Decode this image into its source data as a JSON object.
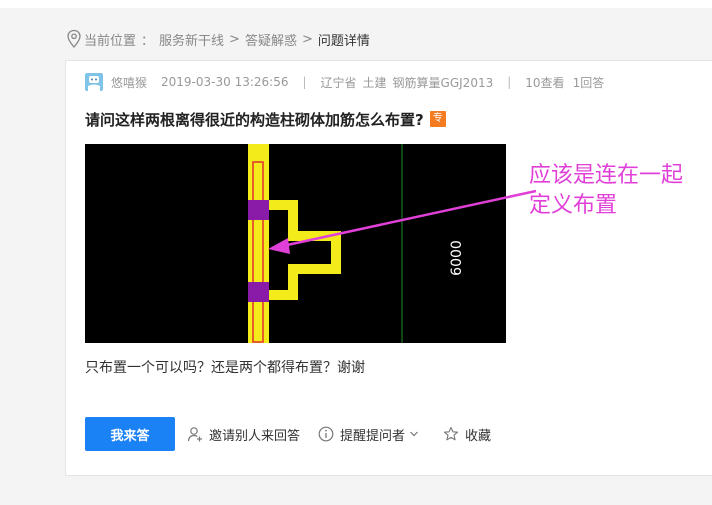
{
  "breadcrumb": {
    "prefix": "当前位置",
    "colon": "：",
    "items": [
      "服务新干线",
      "答疑解惑"
    ],
    "current": "问题详情",
    "separator": ">"
  },
  "question": {
    "user": "悠嘻猴",
    "date": "2019-03-30 13:26:56",
    "bar": "|",
    "region": "辽宁省",
    "category": "土建",
    "software": "钢筋算量GGJ2013",
    "views": "10查看",
    "answers": "1回答",
    "title": "请问这样两根离得很近的构造柱砌体加筋怎么布置?",
    "badge": "专",
    "body": "只布置一个可以吗？还是两个都得布置？谢谢"
  },
  "figure": {
    "dimension_label": "6000",
    "annotation_line1": "应该是连在一起",
    "annotation_line2": "定义布置"
  },
  "actions": {
    "answer": "我来答",
    "invite": "邀请别人来回答",
    "remind": "提醒提问者",
    "favorite": "收藏"
  },
  "colors": {
    "primary": "#1a82f5",
    "badge": "#f47b20",
    "annotation": "#e040d8"
  }
}
